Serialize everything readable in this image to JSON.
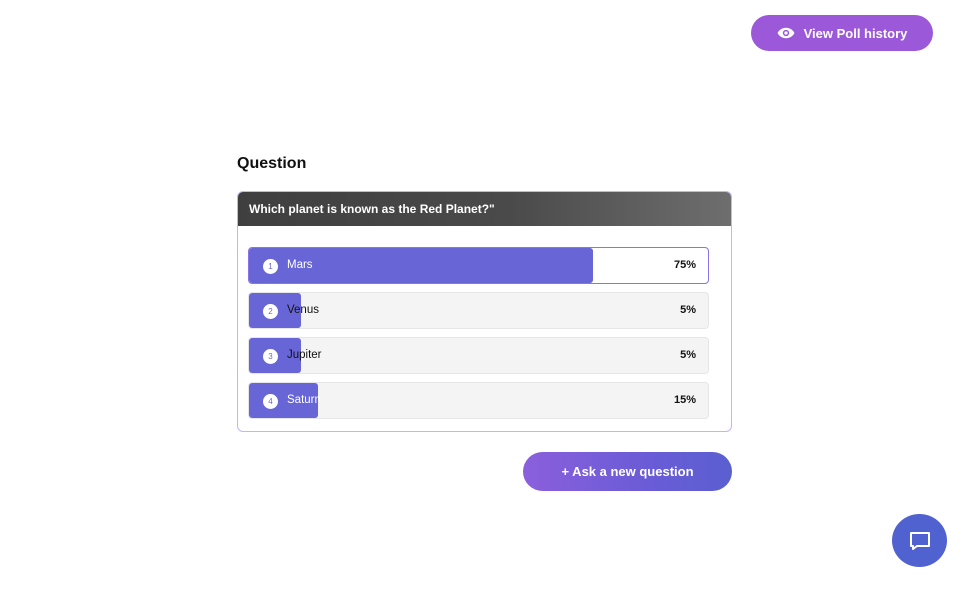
{
  "header": {
    "history_button_label": "View Poll history",
    "history_icon": "eye-icon"
  },
  "poll": {
    "section_title": "Question",
    "question_text": "Which planet is known as the Red Planet?\"",
    "options": [
      {
        "number": "1",
        "label": "Mars",
        "percent_label": "75%",
        "percent": 75,
        "selected": true
      },
      {
        "number": "2",
        "label": "Venus",
        "percent_label": "5%",
        "percent": 5,
        "selected": false
      },
      {
        "number": "3",
        "label": "Jupiter",
        "percent_label": "5%",
        "percent": 5,
        "selected": false
      },
      {
        "number": "4",
        "label": "Saturn",
        "percent_label": "15%",
        "percent": 15,
        "selected": false
      }
    ]
  },
  "actions": {
    "ask_new_label": "+ Ask a new question"
  },
  "chat": {
    "icon": "chat-bubble-icon"
  },
  "colors": {
    "accent_purple": "#9b59d9",
    "bar_fill": "#6866d6",
    "chat_button": "#5062cf",
    "selected_border": "#8b72e6"
  }
}
